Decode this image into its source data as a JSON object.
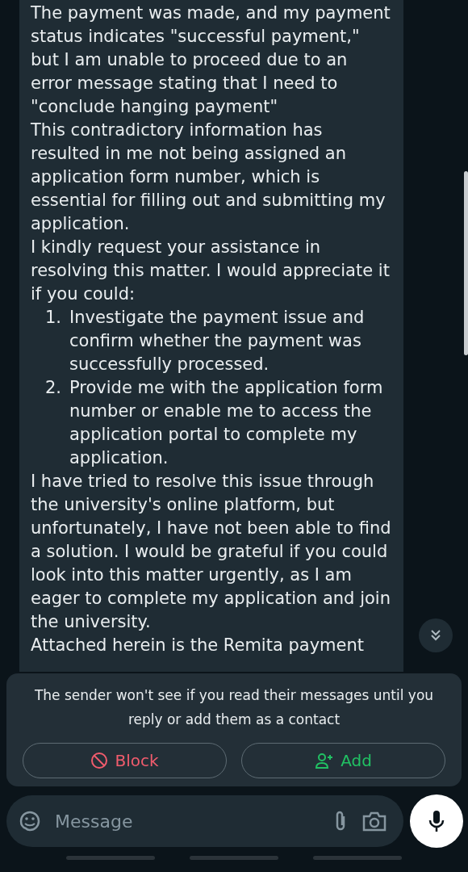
{
  "message": {
    "paragraphs": [
      "The payment was made, and my payment status indicates \"successful payment,\" but I am unable to proceed due to an error message stating that I need to \"conclude hanging payment\"",
      "This contradictory information has resulted in me not being assigned an application form number, which is essential for filling out and submitting my application.",
      "I kindly request your assistance in resolving this matter. I would appreciate it if you could:"
    ],
    "list": [
      {
        "number": "1.",
        "text": "Investigate the payment issue and confirm whether the payment was successfully processed."
      },
      {
        "number": "2.",
        "text": "Provide me with the application form number or enable me to access the application portal to complete my application."
      }
    ],
    "closing": [
      "I have tried to resolve this issue through the university's online platform, but unfortunately, I have not been able to find a solution. I would be grateful if you could look into this matter urgently, as I am eager to complete my application and join the university.",
      "Attached herein is the Remita payment"
    ]
  },
  "banner": {
    "text": "The sender won't see if you read their messages until you reply or add them as a contact",
    "buttons": [
      {
        "kind": "block",
        "label": "Block"
      },
      {
        "kind": "add",
        "label": "Add"
      }
    ]
  },
  "composer": {
    "placeholder": "Message"
  }
}
